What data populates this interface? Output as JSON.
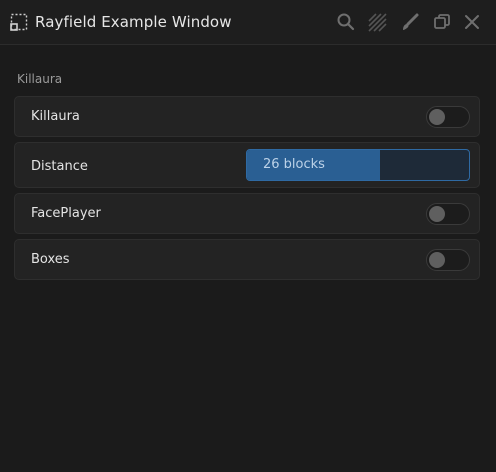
{
  "window": {
    "title": "Rayfield Example Window",
    "icons": [
      "window-logo-icon",
      "search-icon",
      "theme-pattern-icon",
      "brush-icon",
      "restore-icon",
      "close-icon"
    ]
  },
  "section": {
    "title": "Killaura"
  },
  "elements": [
    {
      "type": "toggle",
      "label": "Killaura",
      "value": false
    },
    {
      "type": "slider",
      "label": "Distance",
      "value_text": "26 blocks",
      "value": 26,
      "fill_fraction": 0.6
    },
    {
      "type": "toggle",
      "label": "FacePlayer",
      "value": false
    },
    {
      "type": "toggle",
      "label": "Boxes",
      "value": false
    }
  ],
  "colors": {
    "accent": "#2a5f93",
    "accent_border": "#2f6aa3",
    "background": "#1b1b1b",
    "element_bg": "#232323"
  }
}
